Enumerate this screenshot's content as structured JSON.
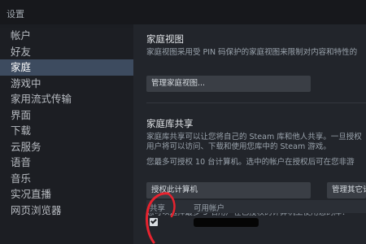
{
  "window": {
    "title": "设置"
  },
  "sidebar": {
    "items": [
      {
        "label": "帐户"
      },
      {
        "label": "好友"
      },
      {
        "label": "家庭",
        "active": true
      },
      {
        "label": "游戏中"
      },
      {
        "label": "家用流式传输"
      },
      {
        "label": "界面"
      },
      {
        "label": "下载"
      },
      {
        "label": "云服务"
      },
      {
        "label": "语音"
      },
      {
        "label": "音乐"
      },
      {
        "label": "实况直播"
      },
      {
        "label": "网页浏览器"
      }
    ]
  },
  "family_view": {
    "title": "家庭视图",
    "description": "家庭视图采用受 PIN 码保护的家庭视图来限制对内容和特性的",
    "manage_button": "管理家庭视图..."
  },
  "library_sharing": {
    "title": "家庭库共享",
    "description_line1": "家庭库共享可以让您将自己的 Steam 库和他人共享。一旦授权",
    "description_line2": "用户将可以访问、下载和使用您库中的 Steam 游戏。",
    "limit_text": "您最多可授权 10 台计算机。选中的帐户在授权后可在您非游",
    "authorize_button": "授权此计算机",
    "manage_other_button": "管理其它计",
    "accounts_text": "您可以选择最多 5 名用户在已授权的计算机上使用您的库：",
    "table": {
      "columns": [
        "共享",
        "可用帐户"
      ],
      "rows": [
        {
          "shared": true
        }
      ]
    }
  },
  "colors": {
    "background": "#22252b",
    "sidebar": "#1c1e23",
    "active_item": "#3d4b5f",
    "button": "#3a3e45",
    "annotation": "#e8232f"
  },
  "icons": {
    "checkbox": "check-icon"
  }
}
